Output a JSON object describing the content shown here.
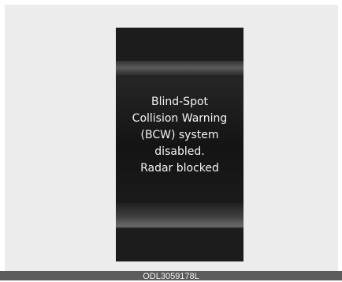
{
  "display": {
    "message_lines": [
      "Blind-Spot",
      "Collision Warning",
      "(BCW) system",
      "disabled.",
      "Radar blocked"
    ]
  },
  "figure": {
    "code": "ODL3059178L"
  }
}
